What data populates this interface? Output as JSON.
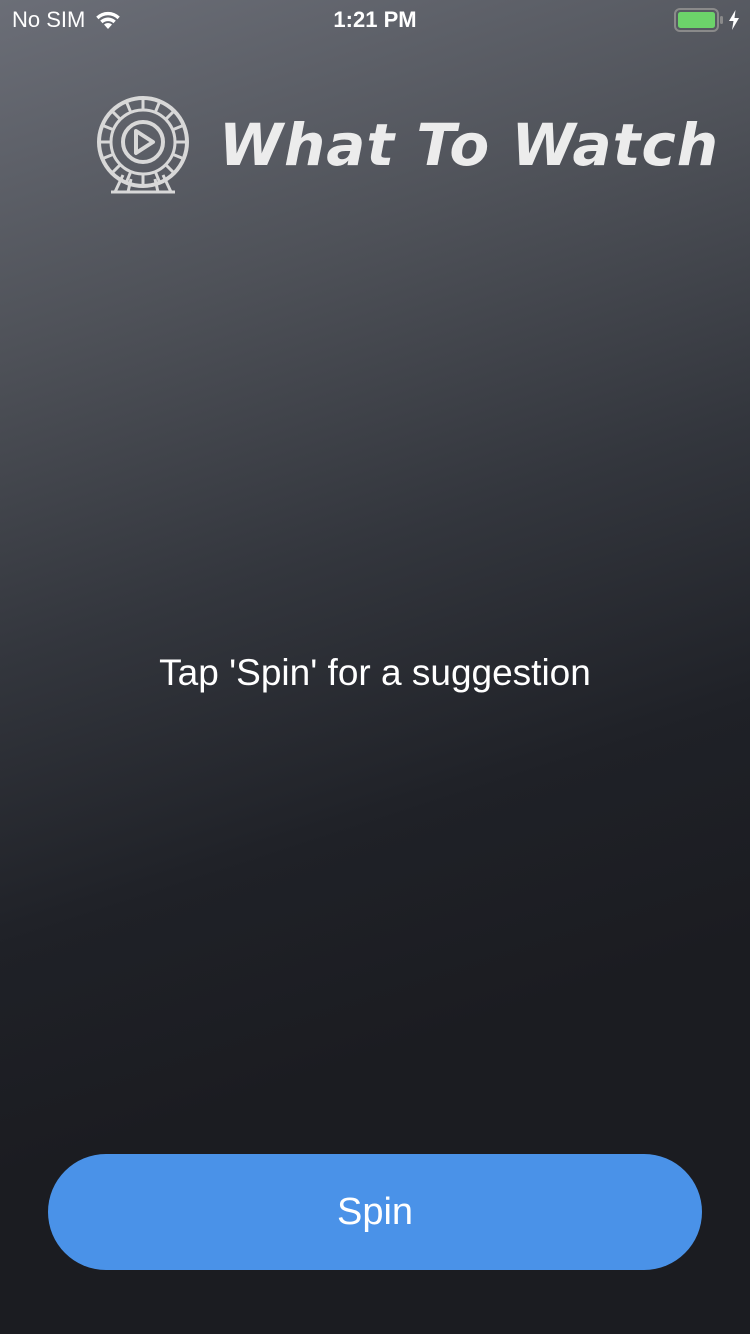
{
  "status_bar": {
    "carrier": "No SIM",
    "time": "1:21 PM",
    "icons": {
      "wifi": "wifi-icon",
      "battery": "battery-charging-icon",
      "bolt": "charging-bolt-icon"
    },
    "battery_color": "#6cd36a"
  },
  "header": {
    "logo_icon": "film-reel-play-icon",
    "title": "What To Watch"
  },
  "main": {
    "prompt": "Tap 'Spin' for a suggestion"
  },
  "actions": {
    "spin_label": "Spin",
    "spin_color": "#4a92e8"
  }
}
